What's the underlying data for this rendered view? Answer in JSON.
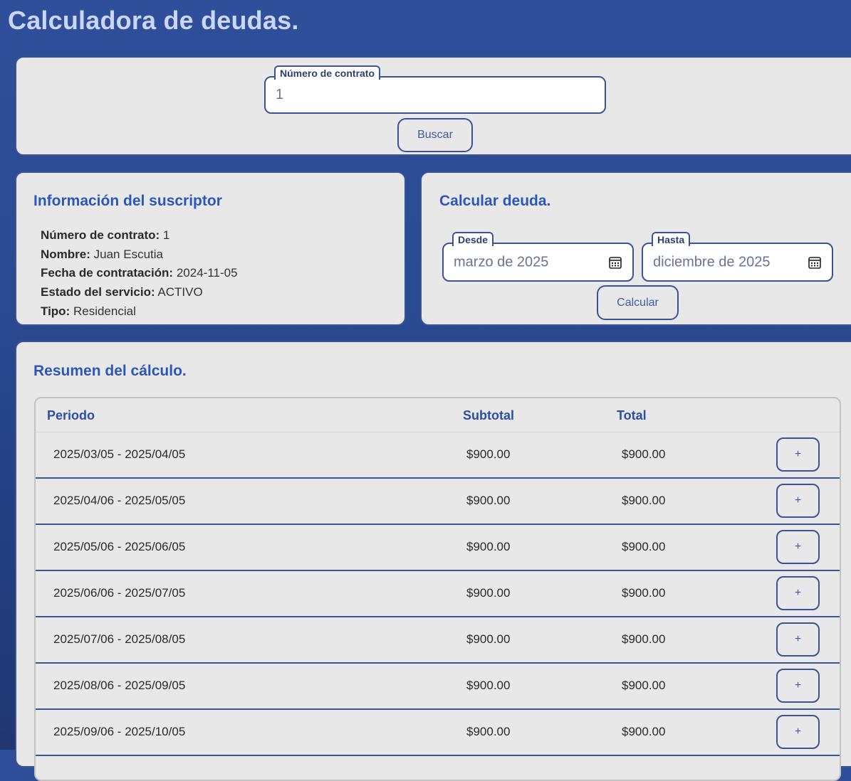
{
  "app": {
    "title": "Calculadora de deudas."
  },
  "search": {
    "field_label": "Número de contrato",
    "field_value": "1",
    "button_label": "Buscar"
  },
  "subscriber": {
    "title": "Información del suscriptor",
    "rows": [
      {
        "label": "Número de contrato:",
        "value": "1"
      },
      {
        "label": "Nombre:",
        "value": "Juan Escutia"
      },
      {
        "label": "Fecha de contratación:",
        "value": "2024-11-05"
      },
      {
        "label": "Estado del servicio:",
        "value": "ACTIVO"
      },
      {
        "label": "Tipo:",
        "value": "Residencial"
      }
    ]
  },
  "calc": {
    "title": "Calcular deuda.",
    "from_label": "Desde",
    "from_value": "marzo de 2025",
    "to_label": "Hasta",
    "to_value": "diciembre de 2025",
    "button_label": "Calcular",
    "icon": "calendar-icon"
  },
  "summary": {
    "title": "Resumen del cálculo.",
    "columns": {
      "period": "Periodo",
      "subtotal": "Subtotal",
      "total": "Total"
    },
    "expand_label": "+",
    "rows": [
      {
        "period": "2025/03/05 - 2025/04/05",
        "subtotal": "$900.00",
        "total": "$900.00"
      },
      {
        "period": "2025/04/06 - 2025/05/05",
        "subtotal": "$900.00",
        "total": "$900.00"
      },
      {
        "period": "2025/05/06 - 2025/06/05",
        "subtotal": "$900.00",
        "total": "$900.00"
      },
      {
        "period": "2025/06/06 - 2025/07/05",
        "subtotal": "$900.00",
        "total": "$900.00"
      },
      {
        "period": "2025/07/06 - 2025/08/05",
        "subtotal": "$900.00",
        "total": "$900.00"
      },
      {
        "period": "2025/08/06 - 2025/09/05",
        "subtotal": "$900.00",
        "total": "$900.00"
      },
      {
        "period": "2025/09/06 - 2025/10/05",
        "subtotal": "$900.00",
        "total": "$900.00"
      }
    ]
  },
  "colors": {
    "background": "#2f4f9a",
    "card": "#e8e8e8",
    "accent": "#2c56b8",
    "border": "#3a5393",
    "title": "#c9d6f6"
  }
}
